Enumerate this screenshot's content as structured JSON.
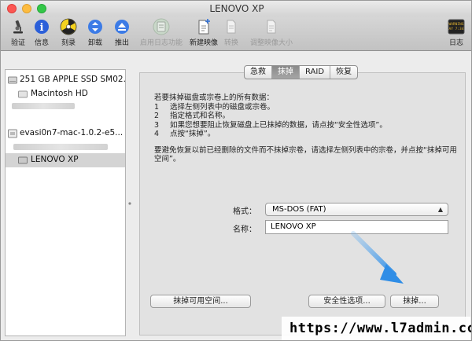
{
  "window": {
    "title": "LENOVO XP"
  },
  "toolbar": {
    "items": [
      {
        "label": "验证",
        "icon": "microscope-icon",
        "enabled": true
      },
      {
        "label": "信息",
        "icon": "info-icon",
        "enabled": true
      },
      {
        "label": "刻录",
        "icon": "burn-icon",
        "enabled": true
      },
      {
        "label": "卸载",
        "icon": "unmount-icon",
        "enabled": true
      },
      {
        "label": "推出",
        "icon": "eject-icon",
        "enabled": true
      },
      {
        "label": "启用日志功能",
        "icon": "journaling-icon",
        "enabled": false
      },
      {
        "label": "新建映像",
        "icon": "new-image-icon",
        "enabled": true
      },
      {
        "label": "转换",
        "icon": "convert-icon",
        "enabled": false
      },
      {
        "label": "调整映像大小",
        "icon": "resize-image-icon",
        "enabled": false
      }
    ],
    "log": {
      "label": "日志",
      "icon_text": [
        "WARNING",
        "AY 7:34"
      ]
    }
  },
  "sidebar": {
    "items": [
      {
        "label": "251 GB APPLE SSD SM02...",
        "level": 0,
        "selected": false
      },
      {
        "label": "Macintosh HD",
        "level": 1,
        "selected": false
      },
      {
        "label": "evasi0n7-mac-1.0.2-e5...",
        "level": 0,
        "selected": false
      },
      {
        "label": "LENOVO XP",
        "level": 1,
        "selected": true
      }
    ]
  },
  "tabs": [
    {
      "label": "急救",
      "active": false
    },
    {
      "label": "抹掉",
      "active": true
    },
    {
      "label": "RAID",
      "active": false
    },
    {
      "label": "恢复",
      "active": false
    }
  ],
  "erase": {
    "intro": "若要抹掉磁盘或宗卷上的所有数据：",
    "steps": [
      {
        "num": "1",
        "text": "选择左侧列表中的磁盘或宗卷。"
      },
      {
        "num": "2",
        "text": "指定格式和名称。"
      },
      {
        "num": "3",
        "text": "如果您想要阻止恢复磁盘上已抹掉的数据，请点按“安全性选项”。"
      },
      {
        "num": "4",
        "text": "点按“抹掉”。"
      }
    ],
    "note": "要避免恢复以前已经删除的文件而不抹掉宗卷，请选择左侧列表中的宗卷，并点按“抹掉可用空间”。",
    "format_label": "格式：",
    "format_value": "MS-DOS (FAT)",
    "name_label": "名称：",
    "name_value": "LENOVO XP",
    "erase_free_space_button": "抹掉可用空间...",
    "security_options_button": "安全性选项...",
    "erase_button": "抹掉..."
  },
  "watermark": "https://www.l7admin.cc",
  "colors": {
    "arrow": "#2f8de6",
    "selected_row": "#d4d4d4",
    "active_tab": "#8a8a8a"
  }
}
